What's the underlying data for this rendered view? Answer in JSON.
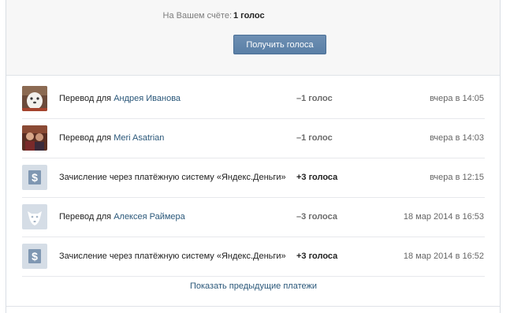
{
  "balance": {
    "label": "На Вашем счёте:",
    "value": "1 голос",
    "button_label": "Получить голоса"
  },
  "payments": [
    {
      "icon": "avatar-photo",
      "prefix": "Перевод для ",
      "name": "Андрея Иванова",
      "amount": "–1 голос",
      "date": "вчера в 14:05"
    },
    {
      "icon": "avatar-photo",
      "prefix": "Перевод для ",
      "name": "Meri Asatrian",
      "amount": "–1 голос",
      "date": "вчера в 14:03"
    },
    {
      "icon": "dollar-icon",
      "prefix": "Зачисление через платёжную систему «Яндекс.Деньги»",
      "name": "",
      "amount": "+3 голоса",
      "date": "вчера в 12:15"
    },
    {
      "icon": "default-avatar-icon",
      "prefix": "Перевод для ",
      "name": "Алексея Раймера",
      "amount": "–3 голоса",
      "date": "18 мар 2014 в 16:53"
    },
    {
      "icon": "dollar-icon",
      "prefix": "Зачисление через платёжную систему «Яндекс.Деньги»",
      "name": "",
      "amount": "+3 голоса",
      "date": "18 мар 2014 в 16:52"
    }
  ],
  "show_more_label": "Показать предыдущие платежи",
  "colors": {
    "link": "#2b587a",
    "button": "#5e82a8",
    "panel_bg": "#f7f7f7",
    "icon_bg": "#d5dde6"
  }
}
